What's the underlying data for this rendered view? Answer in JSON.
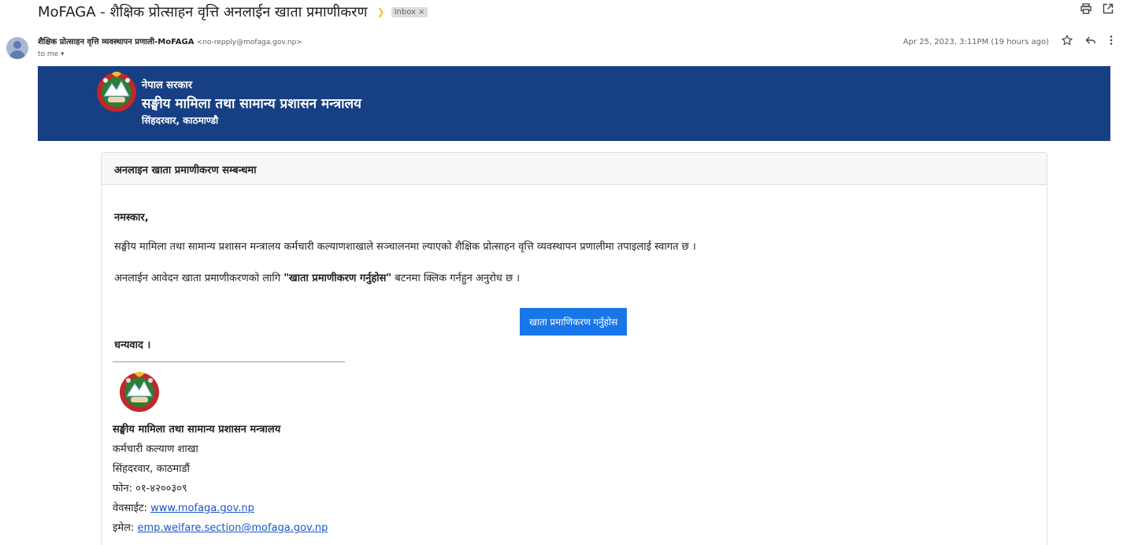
{
  "email": {
    "subject": "MoFAGA - शैक्षिक प्रोत्साहन वृत्ति अनलाईन खाता प्रमाणीकरण",
    "label": "Inbox",
    "label_close": "×",
    "sender_name": "शैक्षिक प्रोत्साहन वृत्ति व्यवस्थापन प्रणाली-MoFAGA",
    "sender_email": "<no-repply@mofaga.gov.np>",
    "to_me": "to me ▾",
    "date": "Apr 25, 2023, 3:11PM (19 hours ago)"
  },
  "icons": {
    "print": "print-icon",
    "popout": "open-in-new-window-icon",
    "star": "star-icon",
    "reply": "reply-icon",
    "more": "more-vertical-icon"
  },
  "banner": {
    "line1": "नेपाल सरकार",
    "line2": "सङ्घीय मामिला तथा सामान्य प्रशासन मन्त्रालय",
    "line3": "सिंहदरवार, काठमाण्डौ"
  },
  "card": {
    "header": "अनलाइन खाता प्रमाणीकरण सम्बन्धमा",
    "greeting": "नमस्कार,",
    "para1": "सङ्घीय मामिला तथा सामान्य प्रशासन मन्त्रालय कर्मचारी कल्याणशाखाले सञ्चालनमा ल्याएको शैक्षिक प्रोत्साहन वृत्ति व्यवस्थापन प्रणालीमा तपाइलाई स्वागत छ ।",
    "para2_before": "अनलाईन आवेदन खाता प्रमाणीकरणको लागि ",
    "para2_bold": "\"खाता प्रमाणीकरण गर्नुहोस\"",
    "para2_after": " बटनमा क्लिक गर्नहुन अनुरोध छ ।",
    "button": "खाता प्रमाणिकरण गर्नुहोस",
    "thanks": "धन्यवाद ।"
  },
  "signature": {
    "org": "सङ्घीय मामिला तथा सामान्य प्रशासन मन्त्रालय",
    "section": "कर्मचारी कल्याण शाखा",
    "address": "सिंहदरवार, काठमाडौं",
    "phone": "फोन: ०१-४२००३०९",
    "website_label": "वेवसाईट: ",
    "website": "www.mofaga.gov.np",
    "email_label": "इमेल: ",
    "email": "emp.welfare.section@mofaga.gov.np"
  },
  "colors": {
    "banner_bg": "#173f84",
    "button_bg": "#1976e9",
    "link": "#1a56c9"
  }
}
